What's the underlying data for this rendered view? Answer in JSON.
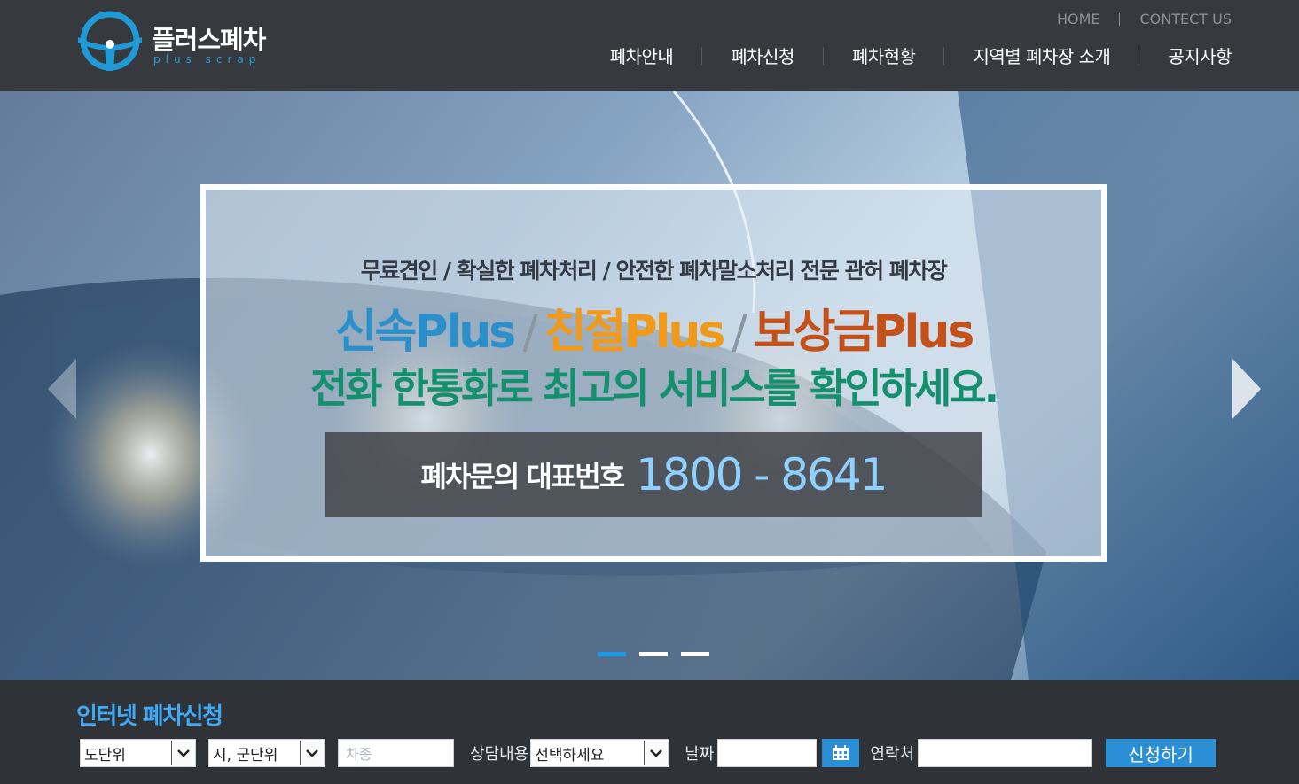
{
  "header": {
    "logo_title": "플러스폐차",
    "logo_sub": "plus scrap",
    "util_links": [
      "HOME",
      "CONTECT US"
    ],
    "nav": [
      "폐차안내",
      "폐차신청",
      "폐차현황",
      "지역별 폐차장 소개",
      "공지사항"
    ]
  },
  "hero": {
    "tagline": "무료견인 / 확실한 폐차처리 / 안전한 폐차말소처리 전문 관허 폐차장",
    "slogan": {
      "part1": "신속Plus",
      "part2": "친절Plus",
      "part3": "보상금Plus",
      "separator": "/"
    },
    "headline": "전화 한통화로 최고의 서비스를 확인하세요.",
    "phone_label": "폐차문의 대표번호",
    "phone_number": "1800 - 8641",
    "slides": 3,
    "active_slide": 1
  },
  "apply": {
    "title": "인터넷 폐차신청",
    "province_select": "도단위",
    "city_select": "시, 군단위",
    "car_type_placeholder": "차종",
    "consult_label": "상담내용",
    "consult_select": "선택하세요",
    "date_label": "날짜",
    "date_value": "",
    "contact_label": "연락처",
    "contact_value": "",
    "submit_label": "신청하기"
  },
  "colors": {
    "header_bg": "#36393e",
    "accent_blue": "#2b8fd6",
    "title_blue": "#3fa9f5",
    "slogan_blue": "#2b8fc9",
    "slogan_orange": "#f19a1a",
    "slogan_red": "#c4501a",
    "headline_green": "#14906e"
  }
}
